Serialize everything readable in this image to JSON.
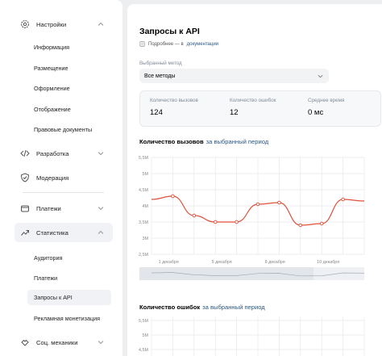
{
  "sidebar": {
    "settings": {
      "label": "Настройки",
      "items": [
        "Информация",
        "Размещение",
        "Оформление",
        "Отображение",
        "Правовые документы"
      ]
    },
    "development": {
      "label": "Разработка"
    },
    "moderation": {
      "label": "Модерация"
    },
    "payments": {
      "label": "Платежи"
    },
    "statistics": {
      "label": "Статистика",
      "items": [
        "Аудитория",
        "Платежи",
        "Запросы к API",
        "Рекламная монетизация"
      ],
      "selected": "Запросы к API"
    },
    "social": {
      "label": "Соц. механики"
    }
  },
  "main": {
    "title": "Запросы к API",
    "doc_prefix": "Подробнее — в",
    "doc_link": "документации",
    "method_label": "Выбранный метод",
    "method_value": "Все методы",
    "stats": [
      {
        "label": "Количество вызовов",
        "value": "124"
      },
      {
        "label": "Количество ошибок",
        "value": "12"
      },
      {
        "label": "Среднее время",
        "value": "0 мс"
      }
    ],
    "charts": [
      {
        "title": "Количество вызовов",
        "period": "за выбранный период"
      },
      {
        "title": "Количество ошибок",
        "period": "за выбранный период"
      }
    ]
  },
  "colors": {
    "accent": "#2a5885",
    "line": "#e0503a"
  },
  "icons": [
    "gear-icon",
    "code-icon",
    "shield-icon",
    "wallet-icon",
    "trend-icon",
    "social-icon",
    "document-icon",
    "chevron-up-icon",
    "chevron-down-icon"
  ],
  "chart_data": [
    {
      "type": "line",
      "title": "Количество вызовов",
      "ylim": [
        2.5,
        5.5
      ],
      "y_ticks": [
        "2,5M",
        "3M",
        "3,5M",
        "4M",
        "4,5M",
        "5M",
        "5,5M"
      ],
      "x_ticks": [
        "1 декабря",
        "5 декабря",
        "8 декабря",
        "10 декабря"
      ],
      "grid": true,
      "series": [
        {
          "values": [
            4.2,
            4.3,
            3.7,
            3.5,
            3.5,
            4.05,
            4.1,
            3.4,
            3.45,
            4.2,
            4.15
          ]
        }
      ]
    },
    {
      "type": "line",
      "title": "Количество ошибок",
      "y_ticks": [
        "4,5M",
        "5M",
        "5,5M"
      ],
      "grid": true
    }
  ]
}
